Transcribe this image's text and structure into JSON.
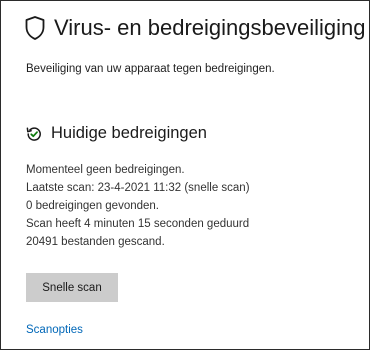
{
  "header": {
    "icon": "shield-icon",
    "title": "Virus- en bedreigingsbeveiliging",
    "subtitle": "Beveiliging van uw apparaat tegen bedreigingen."
  },
  "current_threats": {
    "icon": "threat-history-icon",
    "title": "Huidige bedreigingen",
    "lines": [
      "Momenteel geen bedreigingen.",
      "Laatste scan: 23-4-2021 11:32 (snelle scan)",
      "0 bedreigingen gevonden.",
      "Scan heeft 4 minuten 15 seconden geduurd",
      "20491 bestanden gescand."
    ],
    "quick_scan_label": "Snelle scan",
    "scan_options_label": "Scanopties"
  },
  "colors": {
    "link": "#0067b8",
    "button_bg": "#cccccc",
    "status_ok": "#107c10"
  }
}
